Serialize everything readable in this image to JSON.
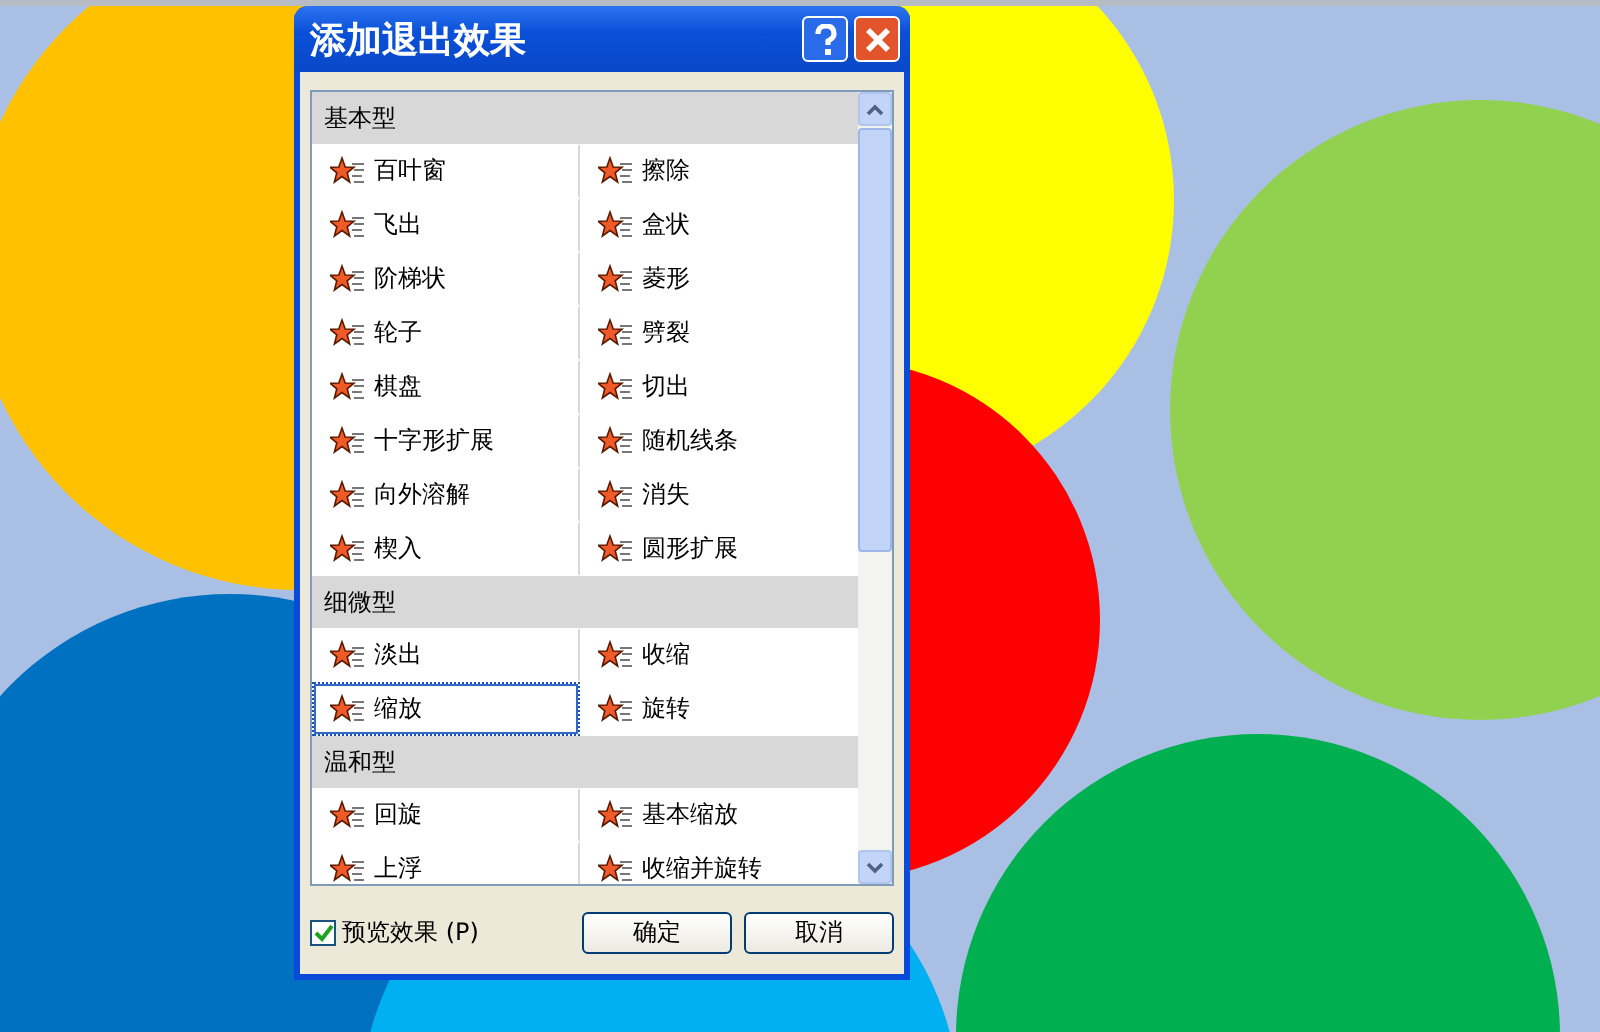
{
  "window": {
    "title": "添加退出效果"
  },
  "groups": [
    {
      "title": "基本型",
      "items": [
        {
          "label": "百叶窗",
          "selected": false
        },
        {
          "label": "擦除",
          "selected": false
        },
        {
          "label": "飞出",
          "selected": false
        },
        {
          "label": "盒状",
          "selected": false
        },
        {
          "label": "阶梯状",
          "selected": false
        },
        {
          "label": "菱形",
          "selected": false
        },
        {
          "label": "轮子",
          "selected": false
        },
        {
          "label": "劈裂",
          "selected": false
        },
        {
          "label": "棋盘",
          "selected": false
        },
        {
          "label": "切出",
          "selected": false
        },
        {
          "label": "十字形扩展",
          "selected": false
        },
        {
          "label": "随机线条",
          "selected": false
        },
        {
          "label": "向外溶解",
          "selected": false
        },
        {
          "label": "消失",
          "selected": false
        },
        {
          "label": "楔入",
          "selected": false
        },
        {
          "label": "圆形扩展",
          "selected": false
        }
      ]
    },
    {
      "title": "细微型",
      "items": [
        {
          "label": "淡出",
          "selected": false
        },
        {
          "label": "收缩",
          "selected": false
        },
        {
          "label": "缩放",
          "selected": true
        },
        {
          "label": "旋转",
          "selected": false
        }
      ]
    },
    {
      "title": "温和型",
      "items": [
        {
          "label": "回旋",
          "selected": false
        },
        {
          "label": "基本缩放",
          "selected": false
        },
        {
          "label": "上浮",
          "selected": false
        },
        {
          "label": "收缩并旋转",
          "selected": false
        }
      ]
    }
  ],
  "preview": {
    "label": "预览效果 (P)",
    "checked": true
  },
  "buttons": [
    "确定",
    "取消"
  ]
}
